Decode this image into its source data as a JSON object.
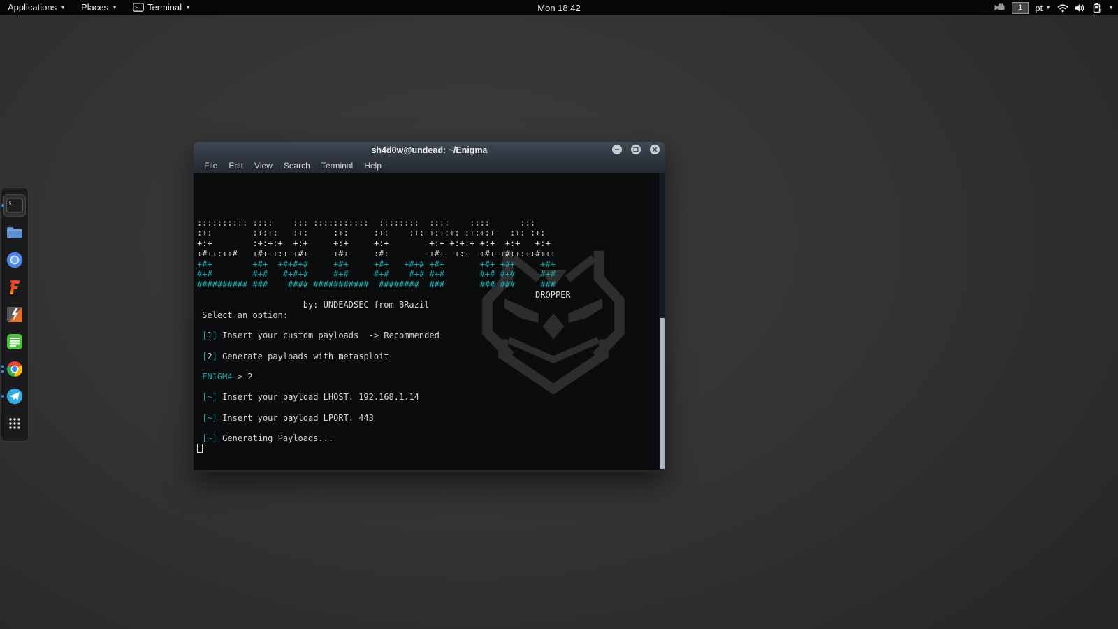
{
  "topbar": {
    "applications": "Applications",
    "places": "Places",
    "app_menu": "Terminal",
    "clock": "Mon 18:42",
    "workspace": "1",
    "keyboard_layout": "pt"
  },
  "dock": {
    "items": [
      {
        "icon": "terminal",
        "name": "terminal",
        "active": true,
        "dots": 1
      },
      {
        "icon": "files",
        "name": "file-manager",
        "active": false,
        "dots": 0
      },
      {
        "icon": "chromium",
        "name": "chromium-browser",
        "active": false,
        "dots": 0
      },
      {
        "icon": "flamef",
        "name": "flame-f-app",
        "active": false,
        "dots": 0
      },
      {
        "icon": "bolt",
        "name": "bolt-app",
        "active": false,
        "dots": 0
      },
      {
        "icon": "notes",
        "name": "notes-app",
        "active": false,
        "dots": 0
      },
      {
        "icon": "chrome",
        "name": "google-chrome",
        "active": false,
        "dots": 2
      },
      {
        "icon": "telegram",
        "name": "telegram",
        "active": false,
        "dots": 1
      },
      {
        "icon": "grid",
        "name": "show-applications",
        "active": false,
        "dots": 0
      }
    ]
  },
  "window": {
    "title": "sh4d0w@undead: ~/Enigma",
    "menu": [
      "File",
      "Edit",
      "View",
      "Search",
      "Terminal",
      "Help"
    ]
  },
  "terminal": {
    "colors": {
      "teal": "#1fa0a3",
      "white": "#d6d6d6"
    },
    "lines": [
      [],
      [
        {
          "c": "w",
          "t": ":::::::::: ::::    ::: :::::::::::  ::::::::  ::::    ::::      :::    "
        }
      ],
      [
        {
          "c": "w",
          "t": ":+:        :+:+:   :+:     :+:     :+:    :+: +:+:+: :+:+:+   :+: :+:  "
        }
      ],
      [
        {
          "c": "w",
          "t": "+:+        :+:+:+  +:+     +:+     +:+        +:+ +:+:+ +:+  +:+   +:+ "
        }
      ],
      [
        {
          "c": "w",
          "t": "+#++:++#   +#+ +:+ +#+     +#+     :#:        +#+  +:+  +#+ +#++:++#++:"
        }
      ],
      [
        {
          "c": "t",
          "t": "+#+        +#+  +#+#+#     +#+     +#+   +#+# +#+       +#+ +#+     +#+"
        }
      ],
      [
        {
          "c": "t",
          "t": "#+#        #+#   #+#+#     #+#     #+#    #+# #+#       #+# #+#     #+#"
        }
      ],
      [
        {
          "c": "t",
          "t": "########## ###    #### ###########  ########  ###       ### ###     ###"
        }
      ],
      [
        {
          "c": "w",
          "t": "                                                                   DROPPER"
        }
      ],
      [
        {
          "c": "w",
          "t": "                     by: UNDEADSEC from BRazil"
        }
      ],
      [
        {
          "c": "w",
          "t": " Select an option:"
        }
      ],
      [],
      [
        {
          "c": "w",
          "t": " "
        },
        {
          "c": "t",
          "t": "["
        },
        {
          "c": "w",
          "t": "1"
        },
        {
          "c": "t",
          "t": "]"
        },
        {
          "c": "w",
          "t": " Insert your custom payloads  -> Recommended"
        }
      ],
      [],
      [
        {
          "c": "w",
          "t": " "
        },
        {
          "c": "t",
          "t": "["
        },
        {
          "c": "w",
          "t": "2"
        },
        {
          "c": "t",
          "t": "]"
        },
        {
          "c": "w",
          "t": " Generate payloads with metasploit"
        }
      ],
      [],
      [
        {
          "c": "w",
          "t": " "
        },
        {
          "c": "t",
          "t": "EN1GM4"
        },
        {
          "c": "w",
          "t": " > 2"
        }
      ],
      [],
      [
        {
          "c": "w",
          "t": " "
        },
        {
          "c": "t",
          "t": "[~]"
        },
        {
          "c": "w",
          "t": " Insert your payload LHOST: 192.168.1.14"
        }
      ],
      [],
      [
        {
          "c": "w",
          "t": " "
        },
        {
          "c": "t",
          "t": "[~]"
        },
        {
          "c": "w",
          "t": " Insert your payload LPORT: 443"
        }
      ],
      [],
      [
        {
          "c": "w",
          "t": " "
        },
        {
          "c": "t",
          "t": "[~]"
        },
        {
          "c": "w",
          "t": " Generating Payloads..."
        }
      ],
      [
        {
          "cursor": true
        }
      ]
    ]
  }
}
